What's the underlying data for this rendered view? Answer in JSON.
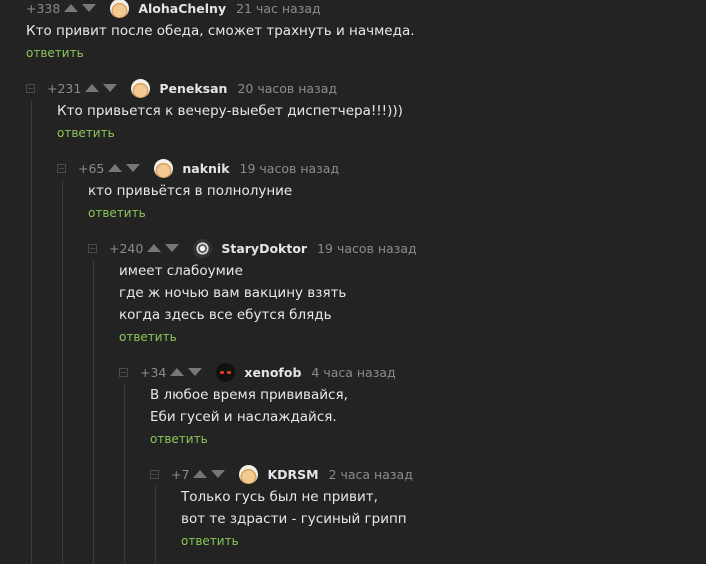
{
  "reply_label": "ответить",
  "colors": {
    "background": "#232323",
    "reply_link": "#8ac858",
    "meta": "#8b8b8b"
  },
  "comments": [
    {
      "rating": "+338",
      "username": "AlohaChelny",
      "time": "21 час назад",
      "avatar": "cat-avatar-icon",
      "lines": [
        "Кто привит после обеда,  сможет трахнуть и начмеда."
      ]
    },
    {
      "rating": "+231",
      "username": "Peneksan",
      "time": "20 часов назад",
      "avatar": "cat-avatar-icon",
      "lines": [
        "Кто привьется к вечеру-выебет диспетчера!!!)))"
      ]
    },
    {
      "rating": "+65",
      "username": "naknik",
      "time": "19 часов назад",
      "avatar": "cat-avatar-icon",
      "lines": [
        "кто привьётся в полнолуние"
      ]
    },
    {
      "rating": "+240",
      "username": "StaryDoktor",
      "time": "19 часов назад",
      "avatar": "doctor-avatar-icon",
      "lines": [
        "имеет слабоумие",
        "где ж ночью вам вакцину взять",
        "когда здесь все ебутся блядь"
      ]
    },
    {
      "rating": "+34",
      "username": "xenofob",
      "time": "4 часа назад",
      "avatar": "dark-eyes-avatar-icon",
      "lines": [
        "В любое время прививайся,",
        "Еби гусей и наслаждайся."
      ]
    },
    {
      "rating": "+7",
      "username": "KDRSM",
      "time": "2 часа назад",
      "avatar": "cat-avatar-icon",
      "lines": [
        "Только гусь был не привит,",
        "вот те здрасти - гусиный грипп"
      ]
    }
  ]
}
